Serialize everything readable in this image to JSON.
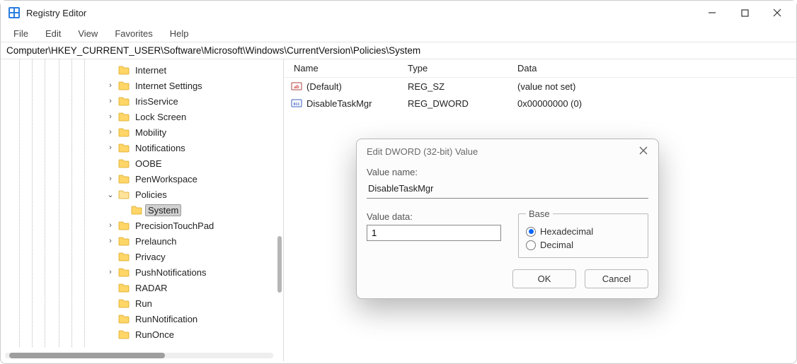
{
  "window": {
    "title": "Registry Editor"
  },
  "menu": {
    "file": "File",
    "edit": "Edit",
    "view": "View",
    "favorites": "Favorites",
    "help": "Help"
  },
  "address": "Computer\\HKEY_CURRENT_USER\\Software\\Microsoft\\Windows\\CurrentVersion\\Policies\\System",
  "tree": [
    {
      "label": "Internet",
      "expander": "",
      "indent": 1
    },
    {
      "label": "Internet Settings",
      "expander": ">",
      "indent": 1
    },
    {
      "label": "IrisService",
      "expander": ">",
      "indent": 1
    },
    {
      "label": "Lock Screen",
      "expander": ">",
      "indent": 1
    },
    {
      "label": "Mobility",
      "expander": ">",
      "indent": 1
    },
    {
      "label": "Notifications",
      "expander": ">",
      "indent": 1
    },
    {
      "label": "OOBE",
      "expander": "",
      "indent": 1
    },
    {
      "label": "PenWorkspace",
      "expander": ">",
      "indent": 1
    },
    {
      "label": "Policies",
      "expander": "v",
      "indent": 1
    },
    {
      "label": "System",
      "expander": "",
      "indent": 2,
      "selected": true
    },
    {
      "label": "PrecisionTouchPad",
      "expander": ">",
      "indent": 1
    },
    {
      "label": "Prelaunch",
      "expander": ">",
      "indent": 1
    },
    {
      "label": "Privacy",
      "expander": "",
      "indent": 1
    },
    {
      "label": "PushNotifications",
      "expander": ">",
      "indent": 1
    },
    {
      "label": "RADAR",
      "expander": "",
      "indent": 1
    },
    {
      "label": "Run",
      "expander": "",
      "indent": 1
    },
    {
      "label": "RunNotification",
      "expander": "",
      "indent": 1
    },
    {
      "label": "RunOnce",
      "expander": "",
      "indent": 1
    }
  ],
  "values": {
    "columns": {
      "name": "Name",
      "type": "Type",
      "data": "Data"
    },
    "rows": [
      {
        "icon": "sz",
        "name": "(Default)",
        "type": "REG_SZ",
        "data": "(value not set)"
      },
      {
        "icon": "dword",
        "name": "DisableTaskMgr",
        "type": "REG_DWORD",
        "data": "0x00000000 (0)"
      }
    ]
  },
  "dialog": {
    "title": "Edit DWORD (32-bit) Value",
    "value_name_label": "Value name:",
    "value_name": "DisableTaskMgr",
    "value_data_label": "Value data:",
    "value_data": "1",
    "base_label": "Base",
    "hex_label": "Hexadecimal",
    "dec_label": "Decimal",
    "base_selected": "hex",
    "ok": "OK",
    "cancel": "Cancel"
  }
}
